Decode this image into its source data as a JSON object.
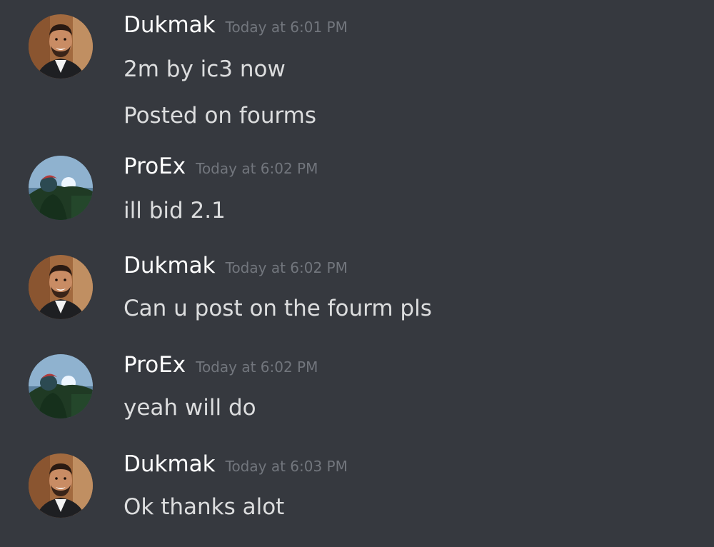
{
  "messages": [
    {
      "author": "Dukmak",
      "timestamp": "Today at 6:01 PM",
      "avatar": "dukmak-avatar",
      "lines": [
        "2m by ic3 now",
        "Posted on fourms"
      ]
    },
    {
      "author": "ProEx",
      "timestamp": "Today at 6:02 PM",
      "avatar": "proex-avatar",
      "lines": [
        "ill bid 2.1"
      ]
    },
    {
      "author": "Dukmak",
      "timestamp": "Today at 6:02 PM",
      "avatar": "dukmak-avatar",
      "lines": [
        "Can u post on the fourm pls"
      ]
    },
    {
      "author": "ProEx",
      "timestamp": "Today at 6:02 PM",
      "avatar": "proex-avatar",
      "lines": [
        "yeah will do"
      ]
    },
    {
      "author": "Dukmak",
      "timestamp": "Today at 6:03 PM",
      "avatar": "dukmak-avatar",
      "lines": [
        "Ok thanks alot"
      ]
    }
  ],
  "colors": {
    "background": "#36393f",
    "username": "#ffffff",
    "timestamp": "#72767d",
    "message_text": "#dcddde"
  }
}
